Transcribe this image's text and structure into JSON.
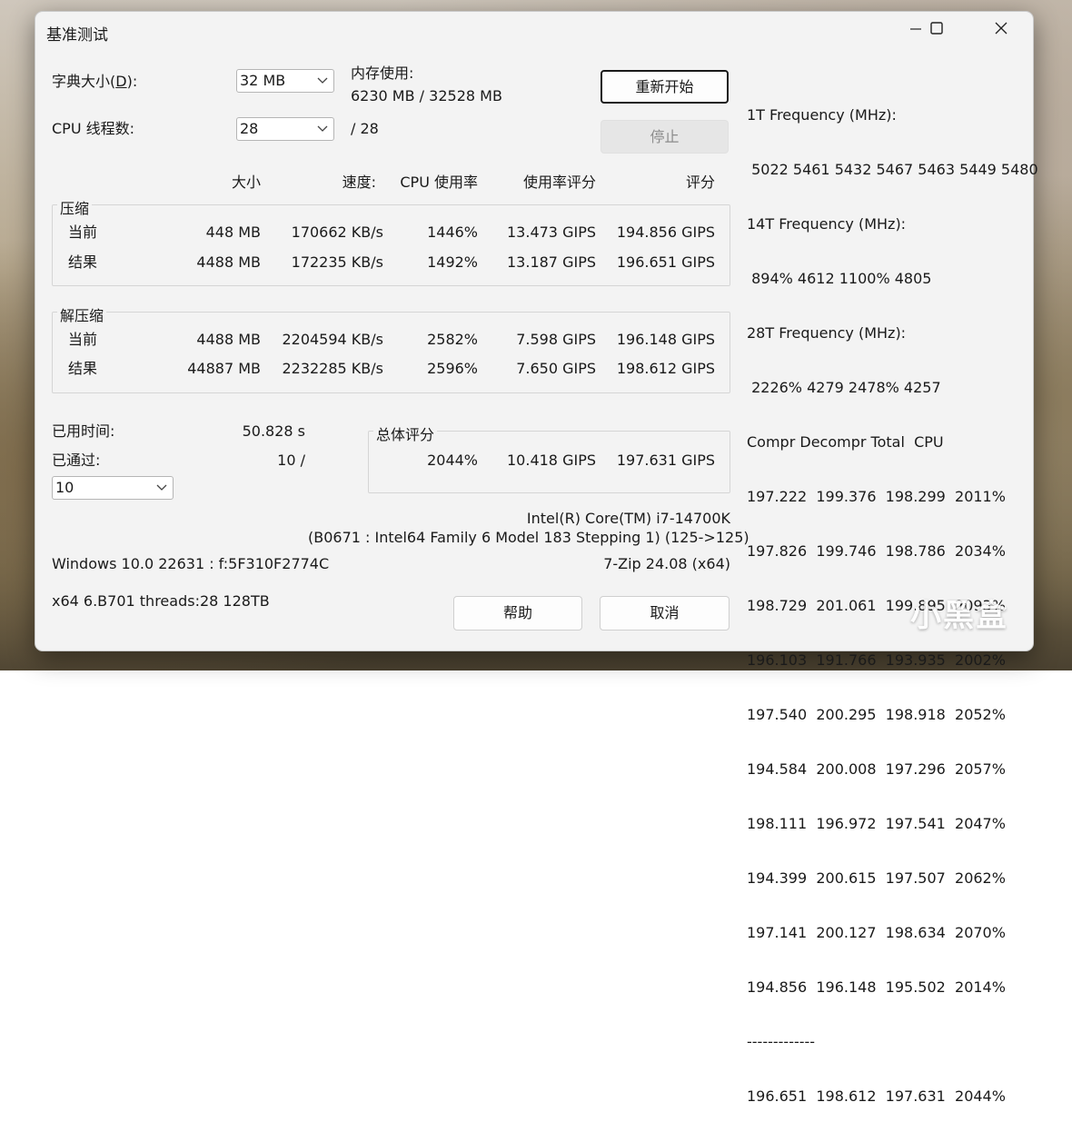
{
  "window": {
    "title": "基准测试"
  },
  "settings": {
    "dict_label": "字典大小(",
    "dict_key": "D",
    "dict_suffix": "):",
    "dict_value": "32 MB",
    "threads_label": "CPU 线程数:",
    "threads_value": "28",
    "threads_total": "/ 28",
    "mem_label": "内存使用:",
    "mem_value": "6230 MB / 32528 MB"
  },
  "buttons": {
    "restart": "重新开始",
    "stop": "停止",
    "help": "帮助",
    "cancel": "取消"
  },
  "columns": {
    "size": "大小",
    "speed": "速度:",
    "cpu_usage": "CPU 使用率",
    "usage_rating": "使用率评分",
    "rating": "评分"
  },
  "compress": {
    "label": "压缩",
    "rows": [
      {
        "name": "当前",
        "size": "448 MB",
        "speed": "170662 KB/s",
        "usage": "1446%",
        "urating": "13.473 GIPS",
        "rating": "194.856 GIPS"
      },
      {
        "name": "结果",
        "size": "4488 MB",
        "speed": "172235 KB/s",
        "usage": "1492%",
        "urating": "13.187 GIPS",
        "rating": "196.651 GIPS"
      }
    ]
  },
  "decompress": {
    "label": "解压缩",
    "rows": [
      {
        "name": "当前",
        "size": "4488 MB",
        "speed": "2204594 KB/s",
        "usage": "2582%",
        "urating": "7.598 GIPS",
        "rating": "196.148 GIPS"
      },
      {
        "name": "结果",
        "size": "44887 MB",
        "speed": "2232285 KB/s",
        "usage": "2596%",
        "urating": "7.650 GIPS",
        "rating": "198.612 GIPS"
      }
    ]
  },
  "elapsed": {
    "label": "已用时间:",
    "value": "50.828 s"
  },
  "passes": {
    "label": "已通过:",
    "value": "10 /",
    "select_value": "10"
  },
  "total": {
    "label": "总体评分",
    "usage": "2044%",
    "urating": "10.418 GIPS",
    "rating": "197.631 GIPS"
  },
  "cpu_info": {
    "name": "Intel(R) Core(TM) i7-14700K",
    "detail": "(B0671 : Intel64 Family 6 Model 183 Stepping 1) (125->125)"
  },
  "os_info": "Windows 10.0 22631 :  f:5F310F2774C",
  "version": "7-Zip 24.08 (x64)",
  "build_info": "x64 6.B701 threads:28 128TB",
  "log": [
    "1T Frequency (MHz):",
    " 5022 5461 5432 5467 5463 5449 5480",
    "14T Frequency (MHz):",
    " 894% 4612 1100% 4805",
    "28T Frequency (MHz):",
    " 2226% 4279 2478% 4257",
    "Compr Decompr Total  CPU",
    "197.222  199.376  198.299  2011%",
    "197.826  199.746  198.786  2034%",
    "198.729  201.061  199.895  2093%",
    "196.103  191.766  193.935  2002%",
    "197.540  200.295  198.918  2052%",
    "194.584  200.008  197.296  2057%",
    "198.111  196.972  197.541  2047%",
    "194.399  200.615  197.507  2062%",
    "197.141  200.127  198.634  2070%",
    "194.856  196.148  195.502  2014%",
    "-------------",
    "196.651  198.612  197.631  2044%"
  ],
  "watermark": "小黑盒",
  "icons": [
    "minimize-icon",
    "maximize-icon",
    "close-icon",
    "chevron-down-icon"
  ]
}
